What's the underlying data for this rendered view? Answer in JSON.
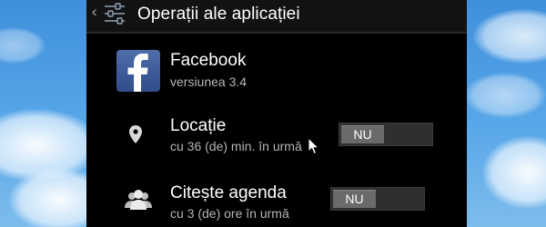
{
  "window": {
    "back_icon": "chevron-left-icon",
    "app_icon": "settings-sliders-icon",
    "title": "Operații ale aplicației"
  },
  "app": {
    "name": "Facebook",
    "version": "versiunea 3.4",
    "icon": "facebook-icon"
  },
  "permissions": [
    {
      "icon": "location-pin-icon",
      "title": "Locație",
      "subtitle": "cu 36 (de) min. în urmă",
      "toggle_label": "NU",
      "enabled": false
    },
    {
      "icon": "contacts-group-icon",
      "title": "Citește agenda",
      "subtitle": "cu 3 (de) ore în urmă",
      "toggle_label": "NU",
      "enabled": false
    }
  ],
  "colors": {
    "facebook_blue": "#3b5998",
    "background_sky": "#4d9be0",
    "toggle_off": "#6a6a6a"
  }
}
